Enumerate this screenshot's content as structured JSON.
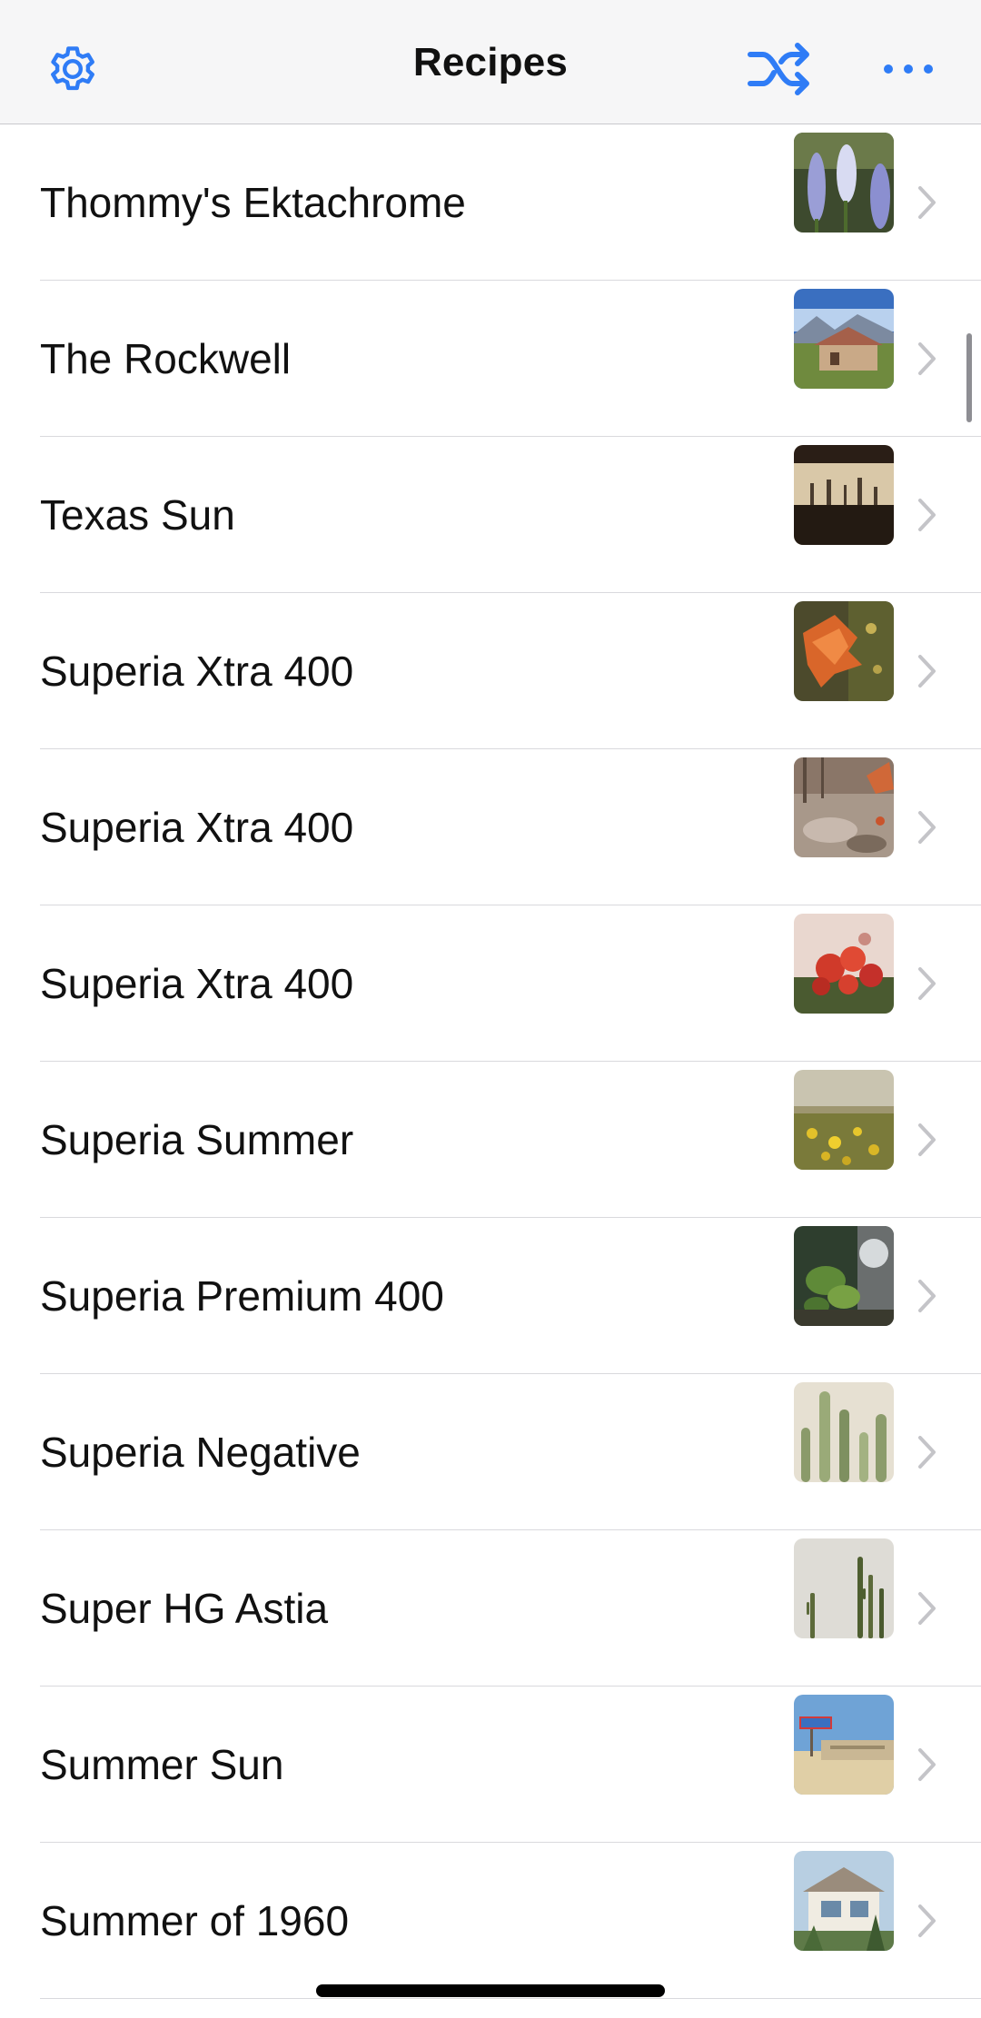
{
  "header": {
    "title": "Recipes",
    "left_icon": "gear-icon",
    "right_icons": [
      "shuffle-icon",
      "more-icon"
    ]
  },
  "colors": {
    "accent": "#2f7cf6",
    "separator": "#d9d9dd",
    "chevron": "#c4c4c8"
  },
  "recipes": [
    {
      "name": "Thommy's Ektachrome",
      "thumbnail": "lupine flowers"
    },
    {
      "name": "The Rockwell",
      "thumbnail": "cabin with mountains"
    },
    {
      "name": "Texas Sun",
      "thumbnail": "refinery at dusk"
    },
    {
      "name": "Superia Xtra 400",
      "thumbnail": "autumn leaf"
    },
    {
      "name": "Superia Xtra 400",
      "thumbnail": "rocky forest floor"
    },
    {
      "name": "Superia Xtra 400",
      "thumbnail": "red flowers"
    },
    {
      "name": "Superia Summer",
      "thumbnail": "yellow wildflowers field"
    },
    {
      "name": "Superia Premium 400",
      "thumbnail": "green leaves"
    },
    {
      "name": "Superia Negative",
      "thumbnail": "cactus"
    },
    {
      "name": "Super HG Astia",
      "thumbnail": "cacti against wall"
    },
    {
      "name": "Summer Sun",
      "thumbnail": "motel sign"
    },
    {
      "name": "Summer of 1960",
      "thumbnail": "house with palm"
    }
  ]
}
